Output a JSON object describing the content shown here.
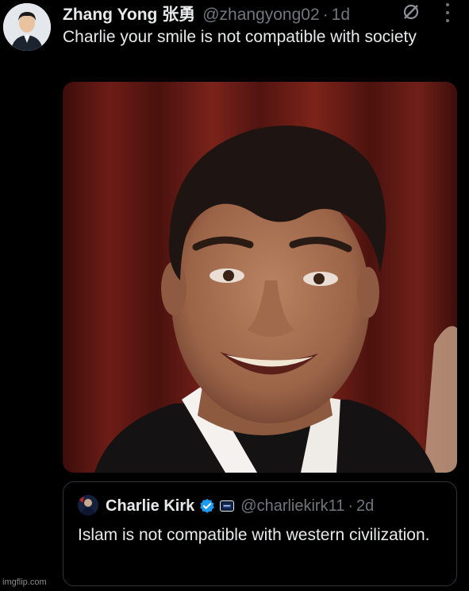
{
  "tweet": {
    "author_name": "Zhang Yong 张勇",
    "handle": "@zhangyong02",
    "separator": "·",
    "time": "1d",
    "text": "Charlie your smile is not compatible with society"
  },
  "quoted_tweet": {
    "author_name": "Charlie Kirk",
    "handle": "@charliekirk11",
    "separator": "·",
    "time": "2d",
    "text": "Islam is not compatible with western civilization."
  },
  "watermark": "imgflip.com",
  "colors": {
    "background": "#000000",
    "primary_text": "#e7e9ea",
    "secondary_text": "#71767b",
    "verified_blue": "#1d9bf0",
    "border": "#2f3336"
  },
  "icons": {
    "grok": "grok-icon",
    "more": "more-icon",
    "verified": "verified-badge-icon"
  }
}
